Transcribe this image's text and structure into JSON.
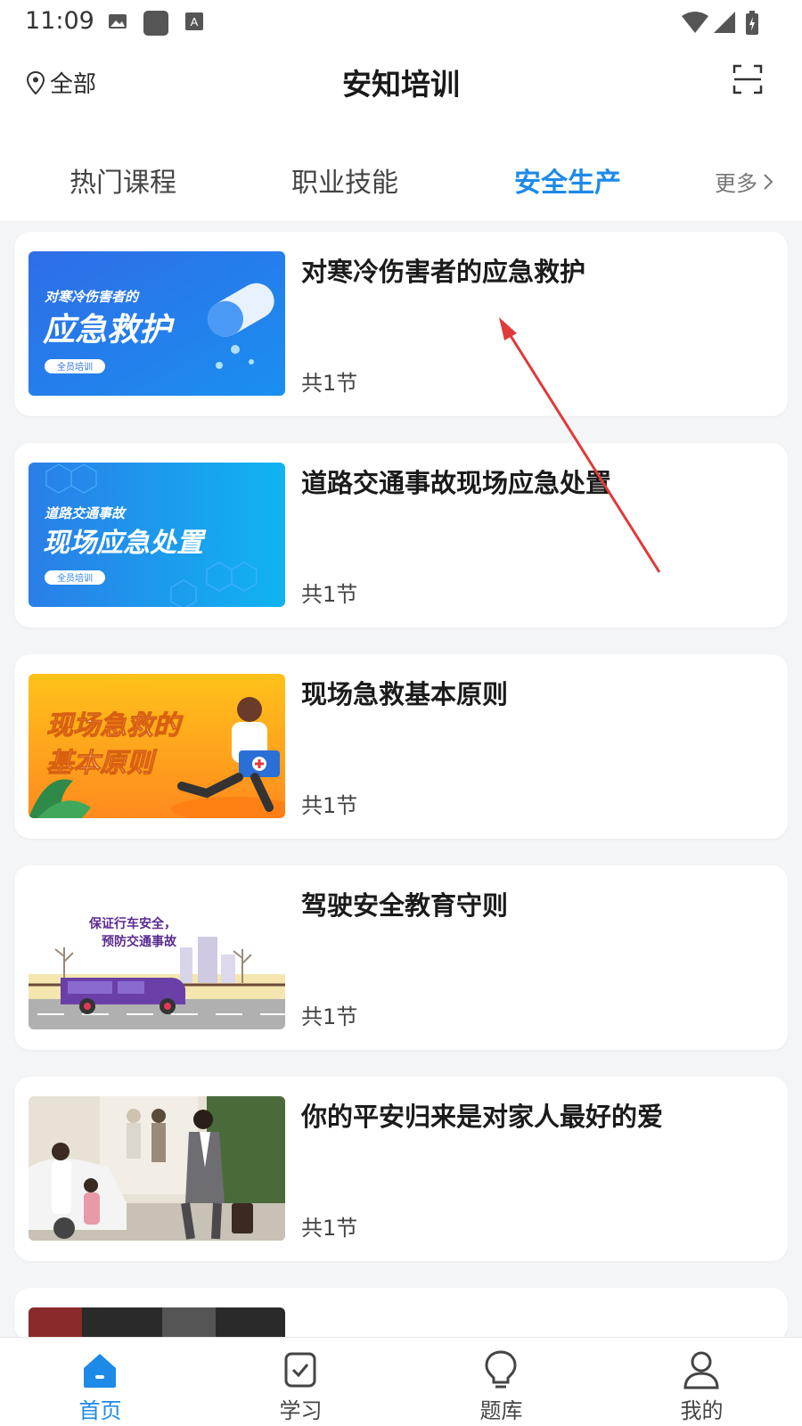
{
  "status_bar": {
    "time": "11:09"
  },
  "header": {
    "location_label": "全部",
    "title": "安知培训"
  },
  "tabs": [
    {
      "label": "热门课程"
    },
    {
      "label": "职业技能"
    },
    {
      "label": "安全生产"
    },
    {
      "label": "更多"
    }
  ],
  "courses": [
    {
      "title": "对寒冷伤害者的应急救护",
      "count": "共1节",
      "thumb_small": "对寒冷伤害者的",
      "thumb_big": "应急救护",
      "thumb_tag": "全员培训"
    },
    {
      "title": "道路交通事故现场应急处置",
      "count": "共1节",
      "thumb_small": "道路交通事故",
      "thumb_big": "现场应急处置",
      "thumb_tag": "全员培训"
    },
    {
      "title": "现场急救基本原则",
      "count": "共1节",
      "thumb_line1": "现场急救的",
      "thumb_line2": "基本原则"
    },
    {
      "title": "驾驶安全教育守则",
      "count": "共1节",
      "thumb_line1": "保证行车安全，",
      "thumb_line2": "预防交通事故"
    },
    {
      "title": "你的平安归来是对家人最好的爱",
      "count": "共1节"
    }
  ],
  "bottom_nav": [
    {
      "label": "首页"
    },
    {
      "label": "学习"
    },
    {
      "label": "题库"
    },
    {
      "label": "我的"
    }
  ],
  "colors": {
    "accent": "#1e8ae8",
    "annotation_arrow": "#e03a3a"
  }
}
